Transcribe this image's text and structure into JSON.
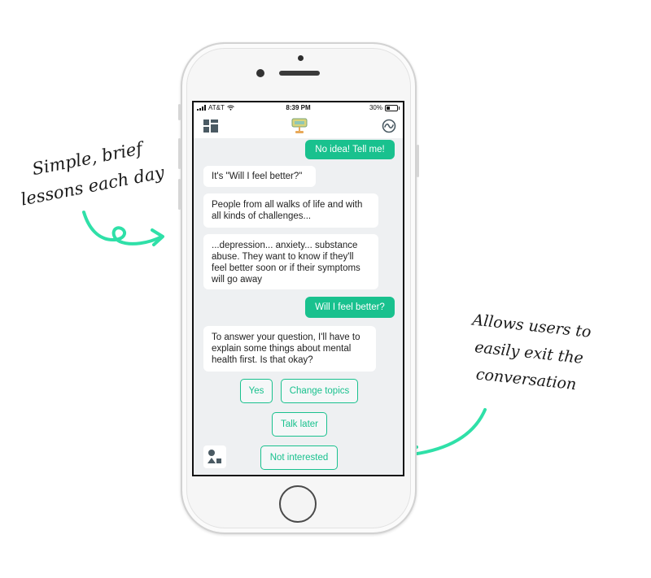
{
  "annotations": {
    "left_lines": [
      "Simple, brief",
      "lessons each day"
    ],
    "right_lines": [
      "Allows users to",
      "easily exit the",
      "conversation"
    ],
    "arrow_color": "#2fe0a8"
  },
  "status_bar": {
    "carrier": "AT&T",
    "time": "8:39 PM",
    "battery": "30%"
  },
  "navbar": {
    "left_icon": "dashboard-icon",
    "center_icon": "woebot-logo-icon",
    "right_icon": "mood-wave-icon"
  },
  "messages": [
    {
      "from": "user",
      "text": "No idea! Tell me!"
    },
    {
      "from": "bot",
      "text": "It's \"Will I feel better?\""
    },
    {
      "from": "bot",
      "text": "People from all walks of life and with all kinds of challenges..."
    },
    {
      "from": "bot",
      "text": "...depression... anxiety... substance abuse. They want to know if they'll feel better soon or if their symptoms will go away"
    },
    {
      "from": "user",
      "text": "Will I feel better?"
    },
    {
      "from": "bot",
      "text": "To answer your question, I'll have to explain some things about mental health first. Is that okay?"
    }
  ],
  "quick_replies": [
    "Yes",
    "Change topics",
    "Talk later",
    "Not interested"
  ],
  "colors": {
    "accent": "#19c18e",
    "chat_background": "#eef0f2"
  }
}
